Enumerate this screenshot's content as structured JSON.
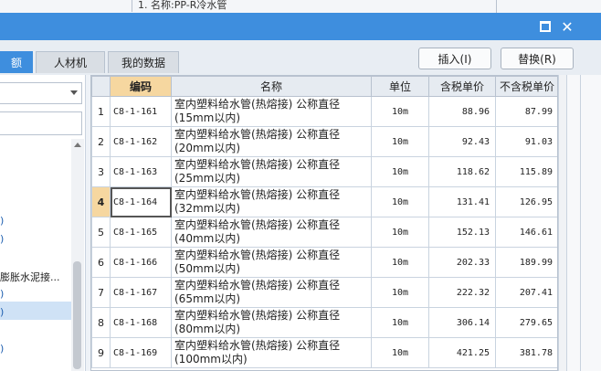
{
  "background": {
    "text": "1. 名称:PP-R冷水管"
  },
  "window": {
    "maximize_glyph": "□",
    "close_glyph": "✕"
  },
  "tabs": [
    {
      "label": "额",
      "active": true
    },
    {
      "label": "人材机",
      "active": false
    },
    {
      "label": "我的数据",
      "active": false
    }
  ],
  "buttons": {
    "insert": "插入(I)",
    "replace": "替换(R)"
  },
  "left_panel": {
    "dropdown_value": "",
    "tree_items": [
      {
        "label": ")"
      },
      {
        "label": ")"
      },
      {
        "label": "膨胀水泥接..."
      },
      {
        "label": ")"
      },
      {
        "label": ")"
      },
      {
        "label": ")"
      }
    ]
  },
  "table": {
    "headers": [
      "",
      "编码",
      "名称",
      "单位",
      "含税单价",
      "不含税单价"
    ],
    "selected_row": 4,
    "rows": [
      {
        "n": "1",
        "code": "C8-1-161",
        "name": "室内塑料给水管(热熔接) 公称直径(15mm以内)",
        "unit": "10m",
        "price_tax": "88.96",
        "price_notax": "87.99"
      },
      {
        "n": "2",
        "code": "C8-1-162",
        "name": "室内塑料给水管(热熔接) 公称直径(20mm以内)",
        "unit": "10m",
        "price_tax": "92.43",
        "price_notax": "91.03"
      },
      {
        "n": "3",
        "code": "C8-1-163",
        "name": "室内塑料给水管(热熔接) 公称直径(25mm以内)",
        "unit": "10m",
        "price_tax": "118.62",
        "price_notax": "115.89"
      },
      {
        "n": "4",
        "code": "C8-1-164",
        "name": "室内塑料给水管(热熔接) 公称直径(32mm以内)",
        "unit": "10m",
        "price_tax": "131.41",
        "price_notax": "126.95"
      },
      {
        "n": "5",
        "code": "C8-1-165",
        "name": "室内塑料给水管(热熔接) 公称直径(40mm以内)",
        "unit": "10m",
        "price_tax": "152.13",
        "price_notax": "146.61"
      },
      {
        "n": "6",
        "code": "C8-1-166",
        "name": "室内塑料给水管(热熔接) 公称直径(50mm以内)",
        "unit": "10m",
        "price_tax": "202.33",
        "price_notax": "189.99"
      },
      {
        "n": "7",
        "code": "C8-1-167",
        "name": "室内塑料给水管(热熔接) 公称直径(65mm以内)",
        "unit": "10m",
        "price_tax": "222.32",
        "price_notax": "207.41"
      },
      {
        "n": "8",
        "code": "C8-1-168",
        "name": "室内塑料给水管(热熔接) 公称直径(80mm以内)",
        "unit": "10m",
        "price_tax": "306.14",
        "price_notax": "279.65"
      },
      {
        "n": "9",
        "code": "C8-1-169",
        "name": "室内塑料给水管(热熔接) 公称直径(100mm以内)",
        "unit": "10m",
        "price_tax": "421.25",
        "price_notax": "381.78"
      }
    ]
  }
}
